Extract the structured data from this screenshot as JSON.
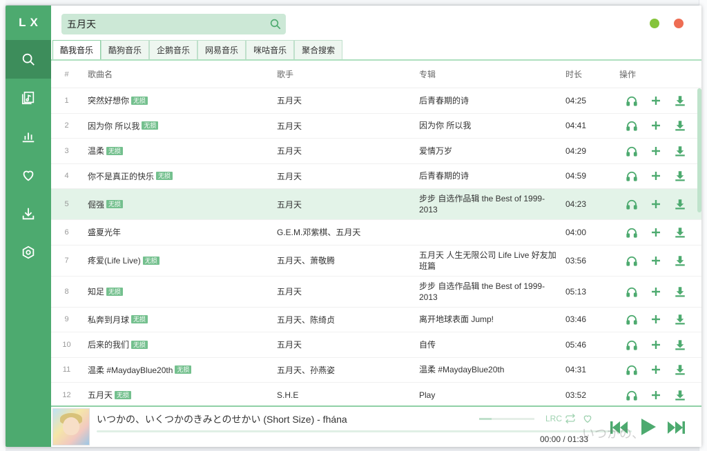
{
  "app": {
    "logo": "LX"
  },
  "sidebar": {
    "items": [
      {
        "icon": "search-icon",
        "active": true
      },
      {
        "icon": "music-list-icon",
        "active": false
      },
      {
        "icon": "chart-icon",
        "active": false
      },
      {
        "icon": "heart-icon",
        "active": false
      },
      {
        "icon": "download-icon",
        "active": false
      },
      {
        "icon": "settings-icon",
        "active": false
      }
    ]
  },
  "search": {
    "value": "五月天"
  },
  "tabs": [
    "酷我音乐",
    "酷狗音乐",
    "企鹅音乐",
    "网易音乐",
    "咪咕音乐",
    "聚合搜索"
  ],
  "table": {
    "headers": {
      "num": "#",
      "name": "歌曲名",
      "artist": "歌手",
      "album": "专辑",
      "duration": "时长",
      "ops": "操作"
    },
    "badge": "无损",
    "rows": [
      {
        "num": "1",
        "name": "突然好想你",
        "lossless": true,
        "artist": "五月天",
        "album": "后青春期的诗",
        "duration": "04:25"
      },
      {
        "num": "2",
        "name": "因为你 所以我",
        "lossless": true,
        "artist": "五月天",
        "album": "因为你 所以我",
        "duration": "04:41"
      },
      {
        "num": "3",
        "name": "温柔",
        "lossless": true,
        "artist": "五月天",
        "album": "爱情万岁",
        "duration": "04:29"
      },
      {
        "num": "4",
        "name": "你不是真正的快乐",
        "lossless": true,
        "artist": "五月天",
        "album": "后青春期的诗",
        "duration": "04:59"
      },
      {
        "num": "5",
        "name": "倔强",
        "lossless": true,
        "artist": "五月天",
        "album": "步步 自选作品辑 the Best of 1999-2013",
        "duration": "04:23",
        "highlight": true
      },
      {
        "num": "6",
        "name": "盛夏光年",
        "lossless": false,
        "artist": "G.E.M.邓紫棋、五月天",
        "album": "",
        "duration": "04:00"
      },
      {
        "num": "7",
        "name": "疼爱(Life Live)",
        "lossless": true,
        "artist": "五月天、萧敬腾",
        "album": "五月天 人生无限公司 Life Live 好友加班篇",
        "duration": "03:56"
      },
      {
        "num": "8",
        "name": "知足",
        "lossless": true,
        "artist": "五月天",
        "album": "步步 自选作品辑 the Best of 1999-2013",
        "duration": "05:13"
      },
      {
        "num": "9",
        "name": "私奔到月球",
        "lossless": true,
        "artist": "五月天、陈绮贞",
        "album": "离开地球表面 Jump!",
        "duration": "03:46"
      },
      {
        "num": "10",
        "name": "后来的我们",
        "lossless": true,
        "artist": "五月天",
        "album": "自传",
        "duration": "05:46"
      },
      {
        "num": "11",
        "name": "温柔 #MaydayBlue20th",
        "lossless": true,
        "artist": "五月天、孙燕姿",
        "album": "温柔 #MaydayBlue20th",
        "duration": "04:31"
      },
      {
        "num": "12",
        "name": "五月天",
        "lossless": true,
        "artist": "S.H.E",
        "album": "Play",
        "duration": "03:52"
      }
    ]
  },
  "player": {
    "title": "いつかの、いくつかのきみとのせかい (Short Size) - fhána",
    "lrc": "LRC",
    "current_time": "00:00",
    "separator": "/",
    "total_time": "01:33",
    "progress": 0,
    "volume": 0.22
  },
  "overlay": {
    "ghost_text": "いつかの、"
  },
  "colors": {
    "accent": "#4daa6f",
    "accent_dark": "#3d8d5b",
    "min_btn": "#85c43b",
    "close_btn": "#ee6d53"
  }
}
